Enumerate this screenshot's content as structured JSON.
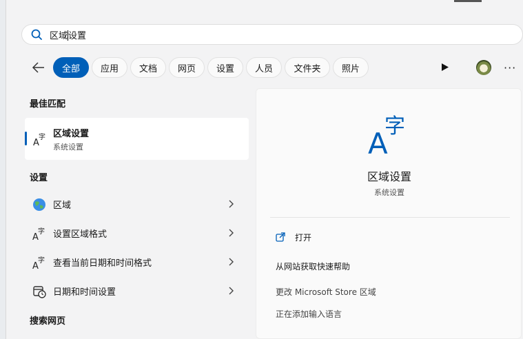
{
  "search": {
    "query_typed": "区域",
    "query_rest": "设置"
  },
  "filters": {
    "chips": [
      {
        "label": "全部",
        "active": true
      },
      {
        "label": "应用",
        "active": false
      },
      {
        "label": "文档",
        "active": false
      },
      {
        "label": "网页",
        "active": false
      },
      {
        "label": "设置",
        "active": false
      },
      {
        "label": "人员",
        "active": false
      },
      {
        "label": "文件夹",
        "active": false
      },
      {
        "label": "照片",
        "active": false
      }
    ],
    "more": "···"
  },
  "sections": {
    "best_match": "最佳匹配",
    "settings": "设置",
    "web": "搜索网页"
  },
  "best_match": {
    "title": "区域设置",
    "subtitle": "系统设置"
  },
  "settings_items": [
    {
      "label": "区域",
      "icon": "globe-icon"
    },
    {
      "label": "设置区域格式",
      "icon": "language-icon"
    },
    {
      "label": "查看当前日期和时间格式",
      "icon": "language-icon"
    },
    {
      "label": "日期和时间设置",
      "icon": "calendar-clock-icon"
    }
  ],
  "detail": {
    "title": "区域设置",
    "subtitle": "系统设置",
    "actions": [
      {
        "label": "打开",
        "icon": "open-external-icon"
      },
      {
        "label": "从网站获取快速帮助"
      },
      {
        "label": "更改 Microsoft Store 区域"
      },
      {
        "label": "正在添加输入语言"
      }
    ]
  },
  "colors": {
    "accent": "#005fb8",
    "panel_bg": "#f3f3f4"
  }
}
